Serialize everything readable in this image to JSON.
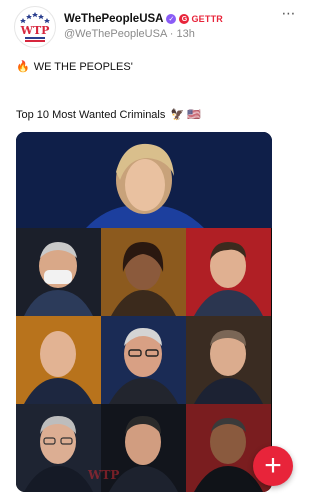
{
  "post": {
    "author": {
      "display_name": "WeThePeopleUSA",
      "handle": "@WeThePeopleUSA",
      "time_ago": "13h",
      "avatar_text": "WTP",
      "network_label": "GETTR"
    },
    "text": {
      "line1_emoji": "🔥",
      "line1": "WE THE PEOPLES'",
      "line2": "Top 10 Most Wanted Criminals",
      "line2_emoji": "🦅 🇺🇸"
    },
    "image": {
      "rows": 4,
      "top_count": 1,
      "grid_columns": 3,
      "watermark": "WTP"
    },
    "more_label": "⋯",
    "fab_label": "+"
  },
  "colors": {
    "brand_red": "#e8243a",
    "verified_purple": "#8a5cf6",
    "muted_text": "#8a8a8a"
  },
  "icons": {
    "more": "more-options-icon",
    "verified": "verified-badge-icon",
    "gettr": "gettr-logo-icon",
    "fab": "plus-icon"
  }
}
